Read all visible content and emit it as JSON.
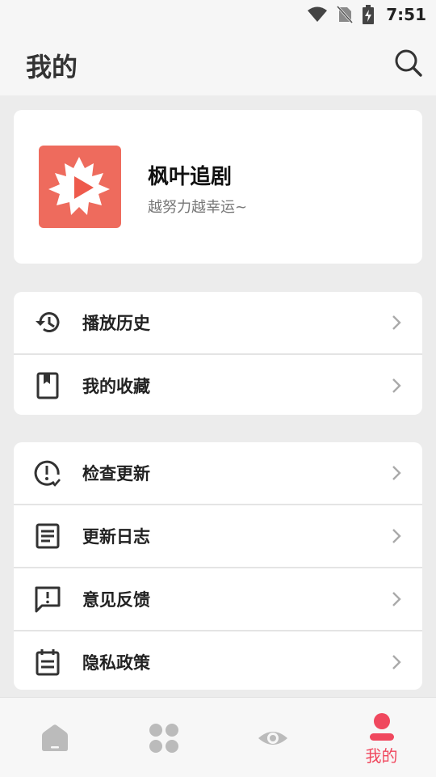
{
  "status_bar": {
    "time": "7:51"
  },
  "header": {
    "title": "我的"
  },
  "profile": {
    "name": "枫叶追剧",
    "slogan": "越努力越幸运~"
  },
  "menu_group_1": [
    {
      "label": "播放历史",
      "icon": "history-icon"
    },
    {
      "label": "我的收藏",
      "icon": "bookmark-icon"
    }
  ],
  "menu_group_2": [
    {
      "label": "检查更新",
      "icon": "update-check-icon"
    },
    {
      "label": "更新日志",
      "icon": "document-icon"
    },
    {
      "label": "意见反馈",
      "icon": "feedback-icon"
    },
    {
      "label": "隐私政策",
      "icon": "calendar-note-icon"
    }
  ],
  "bottom_nav": {
    "active_label": "我的",
    "items": [
      "home-icon",
      "apps-icon",
      "eye-icon",
      "profile-icon"
    ]
  },
  "colors": {
    "accent": "#f0485e",
    "logo_bg": "#ee6b5d"
  }
}
